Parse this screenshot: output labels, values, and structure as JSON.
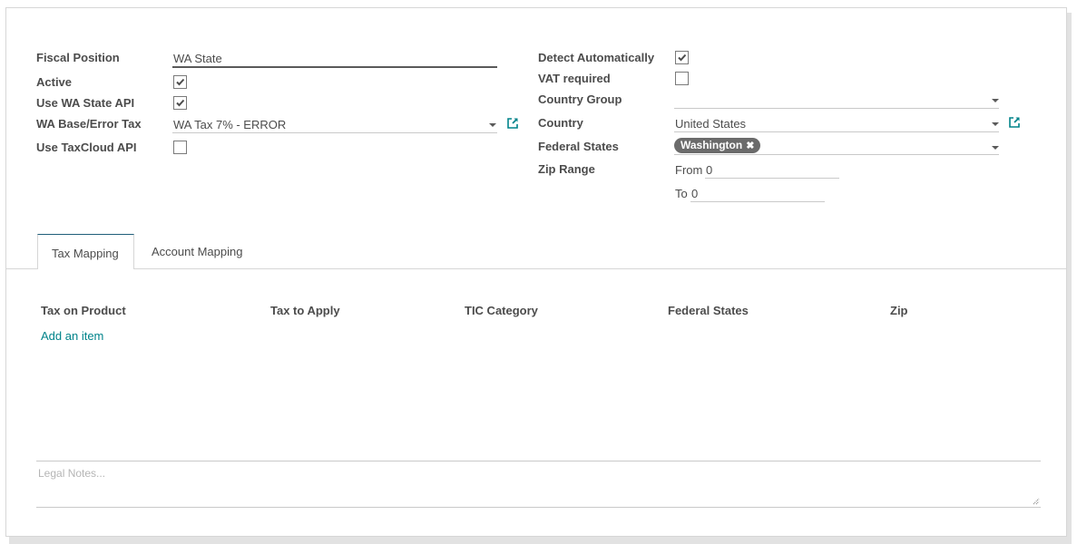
{
  "form": {
    "left": {
      "fiscal_position": {
        "label": "Fiscal Position",
        "value": "WA State"
      },
      "active": {
        "label": "Active",
        "checked": true
      },
      "use_wa_state_api": {
        "label": "Use WA State API",
        "checked": true
      },
      "wa_base_error_tax": {
        "label": "WA Base/Error Tax",
        "value": "WA Tax 7% - ERROR",
        "icon": "external-link-icon"
      },
      "use_taxcloud_api": {
        "label": "Use TaxCloud API",
        "checked": false
      }
    },
    "right": {
      "detect_automatically": {
        "label": "Detect Automatically",
        "checked": true
      },
      "vat_required": {
        "label": "VAT required",
        "checked": false
      },
      "country_group": {
        "label": "Country Group",
        "value": ""
      },
      "country": {
        "label": "Country",
        "value": "United States",
        "icon": "external-link-icon"
      },
      "federal_states": {
        "label": "Federal States",
        "tags": [
          {
            "label": "Washington",
            "remove_glyph": "✖"
          }
        ]
      },
      "zip_range": {
        "label": "Zip Range",
        "from_label": "From",
        "from_value": "0",
        "to_label": "To",
        "to_value": "0"
      }
    }
  },
  "tabs": [
    {
      "label": "Tax Mapping",
      "active": true
    },
    {
      "label": "Account Mapping",
      "active": false
    }
  ],
  "tax_mapping": {
    "columns": [
      "Tax on Product",
      "Tax to Apply",
      "TIC Category",
      "Federal States",
      "Zip"
    ],
    "rows": [],
    "add_item_label": "Add an item"
  },
  "legal_notes": {
    "placeholder": "Legal Notes...",
    "value": ""
  },
  "colors": {
    "accent_link": "#00838a",
    "tab_active_border": "#1f5f7a",
    "tag_background": "#6b6b6b"
  }
}
